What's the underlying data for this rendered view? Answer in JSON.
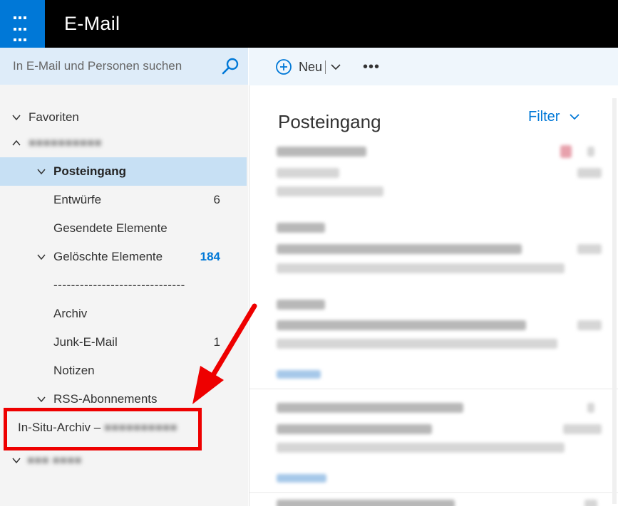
{
  "topbar": {
    "app_title": "E-Mail",
    "waffle_icon": "app-launcher-icon"
  },
  "search": {
    "placeholder": "In E-Mail und Personen suchen",
    "icon": "search-icon"
  },
  "folders": {
    "favorites": "Favoriten",
    "items": [
      {
        "label": "Posteingang"
      },
      {
        "label": "Entwürfe",
        "count": "6"
      },
      {
        "label": "Gesendete Elemente"
      },
      {
        "label": "Gelöschte Elemente",
        "count": "184"
      },
      {
        "label": "------------------------------"
      },
      {
        "label": "Archiv"
      },
      {
        "label": "Junk-E-Mail",
        "count": "1"
      },
      {
        "label": "Notizen"
      },
      {
        "label": "RSS-Abonnements"
      }
    ],
    "in_situ_archive": "In-Situ-Archiv –"
  },
  "commands": {
    "new_label": "Neu",
    "more_label": "•••"
  },
  "message_list": {
    "title": "Posteingang",
    "filter_label": "Filter"
  },
  "colors": {
    "accent": "#0078d7",
    "highlight": "#ee0000",
    "selection": "#c7e0f4"
  }
}
